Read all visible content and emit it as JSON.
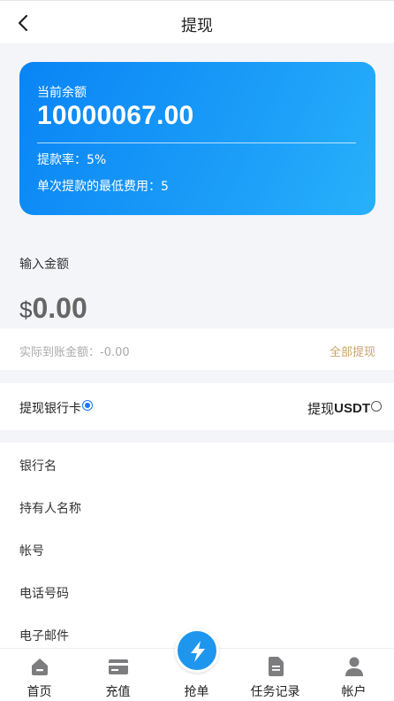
{
  "header": {
    "title": "提现"
  },
  "balance_card": {
    "label": "当前余额",
    "amount": "10000067.00",
    "rate": "提款率：5%",
    "min_fee": "单次提款的最低费用：5"
  },
  "amount": {
    "label": "输入金额",
    "currency": "$",
    "value": "0.00",
    "actual": "实际到账金额：-0.00",
    "withdraw_all": "全部提现"
  },
  "methods": {
    "bank_label": "提现银行卡",
    "usdt_prefix": "提现",
    "usdt_suffix": "USDT",
    "selected": "bank"
  },
  "form": {
    "bank_name": "银行名",
    "holder_name": "持有人名称",
    "account": "帐号",
    "phone": "电话号码",
    "email": "电子邮件"
  },
  "tabbar": {
    "home": "首页",
    "recharge": "充值",
    "grab": "抢单",
    "records": "任务记录",
    "account": "帐户"
  },
  "colors": {
    "card_start": "#0a84f5",
    "card_end": "#27b1fb",
    "accent_gold": "#c9a36a",
    "radio_blue": "#1677ff",
    "tab_icon_gray": "#7d7d80"
  },
  "icons": {
    "back": "chevron-left-icon",
    "home": "home-icon",
    "recharge": "card-icon",
    "grab": "lightning-icon",
    "records": "document-icon",
    "account": "person-icon"
  }
}
